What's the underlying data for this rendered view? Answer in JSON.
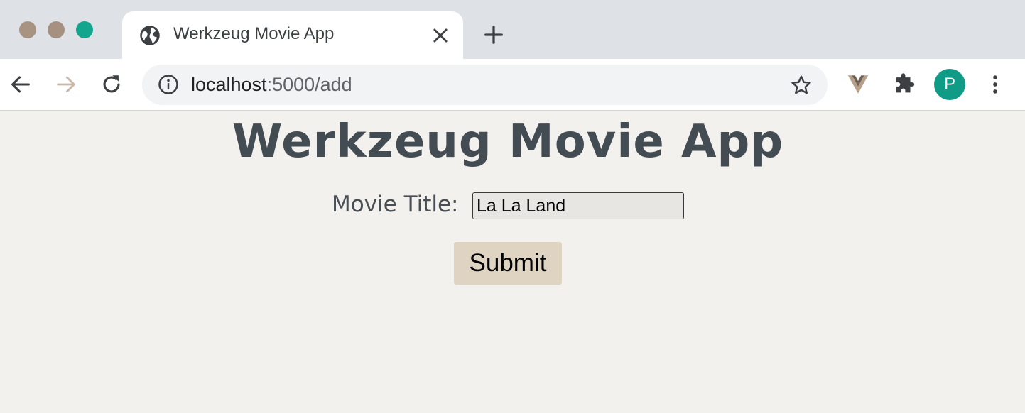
{
  "browser": {
    "tab": {
      "title": "Werkzeug Movie App",
      "favicon_icon": "globe-icon",
      "close_icon": "close-icon"
    },
    "new_tab_icon": "plus-icon",
    "toolbar": {
      "back_icon": "back-arrow-icon",
      "forward_icon": "forward-arrow-icon",
      "reload_icon": "reload-icon",
      "address": {
        "info_icon": "info-icon",
        "host": "localhost",
        "path": ":5000/add",
        "bookmark_icon": "star-icon"
      },
      "extensions": [
        "vue-devtools-icon",
        "puzzle-icon"
      ],
      "profile_initial": "P",
      "menu_icon": "kebab-menu-icon"
    },
    "colors": {
      "tabstrip": "#dee1e6",
      "traffic_close": "#a89383",
      "traffic_min": "#a69180",
      "traffic_max": "#14a58e",
      "avatar": "#109b87"
    }
  },
  "page": {
    "heading": "Werkzeug Movie App",
    "form": {
      "label": "Movie Title:",
      "input_value": "La La Land",
      "submit_label": "Submit"
    },
    "colors": {
      "background": "#f3f1ed",
      "heading": "#434b53",
      "button": "#dfd3c1"
    }
  }
}
